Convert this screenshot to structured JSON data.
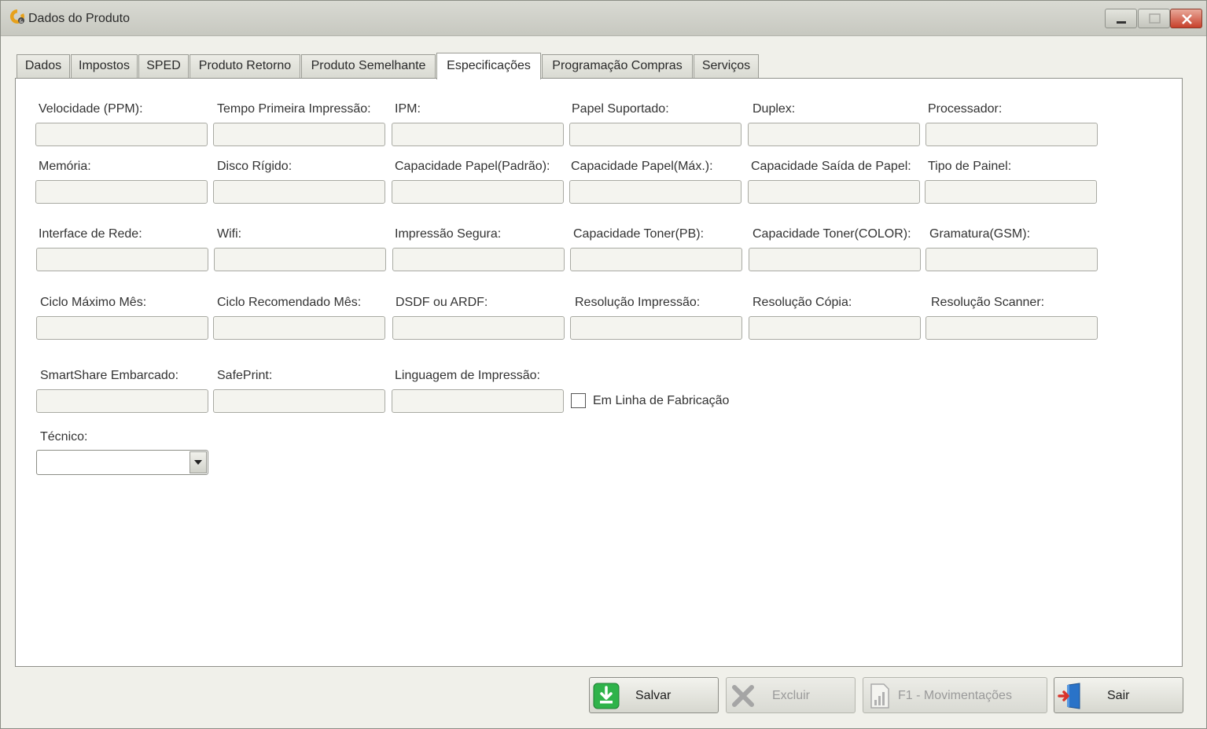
{
  "window": {
    "title": "Dados do Produto"
  },
  "tabs": [
    {
      "label": "Dados"
    },
    {
      "label": "Impostos"
    },
    {
      "label": "SPED"
    },
    {
      "label": "Produto Retorno"
    },
    {
      "label": "Produto Semelhante"
    },
    {
      "label": "Especificações"
    },
    {
      "label": "Programação Compras"
    },
    {
      "label": "Serviços"
    }
  ],
  "active_tab": "Especificações",
  "fields": [
    {
      "label": "Velocidade (PPM):",
      "value": ""
    },
    {
      "label": "Tempo Primeira Impressão:",
      "value": ""
    },
    {
      "label": "IPM:",
      "value": ""
    },
    {
      "label": "Papel Suportado:",
      "value": ""
    },
    {
      "label": "Duplex:",
      "value": ""
    },
    {
      "label": "Processador:",
      "value": ""
    },
    {
      "label": "Memória:",
      "value": ""
    },
    {
      "label": "Disco Rígido:",
      "value": ""
    },
    {
      "label": "Capacidade Papel(Padrão):",
      "value": ""
    },
    {
      "label": "Capacidade Papel(Máx.):",
      "value": ""
    },
    {
      "label": "Capacidade Saída de Papel:",
      "value": ""
    },
    {
      "label": "Tipo de Painel:",
      "value": ""
    },
    {
      "label": "Interface de Rede:",
      "value": ""
    },
    {
      "label": "Wifi:",
      "value": ""
    },
    {
      "label": "Impressão Segura:",
      "value": ""
    },
    {
      "label": "Capacidade Toner(PB):",
      "value": ""
    },
    {
      "label": "Capacidade Toner(COLOR):",
      "value": ""
    },
    {
      "label": "Gramatura(GSM):",
      "value": ""
    },
    {
      "label": "Ciclo Máximo Mês:",
      "value": ""
    },
    {
      "label": "Ciclo Recomendado Mês:",
      "value": ""
    },
    {
      "label": "DSDF ou ARDF:",
      "value": ""
    },
    {
      "label": "Resolução Impressão:",
      "value": ""
    },
    {
      "label": "Resolução Cópia:",
      "value": ""
    },
    {
      "label": "Resolução Scanner:",
      "value": ""
    },
    {
      "label": "SmartShare Embarcado:",
      "value": ""
    },
    {
      "label": "SafePrint:",
      "value": ""
    },
    {
      "label": "Linguagem de Impressão:",
      "value": ""
    }
  ],
  "checkbox": {
    "label": "Em Linha de Fabricação",
    "checked": false
  },
  "tecnico": {
    "label": "Técnico:",
    "value": ""
  },
  "buttons": {
    "salvar": "Salvar",
    "excluir": "Excluir",
    "movimentacoes": "F1 - Movimentações",
    "sair": "Sair"
  },
  "colors": {
    "accent_green": "#2fb34a",
    "accent_blue": "#2a73c8",
    "close_red": "#c7402b"
  }
}
